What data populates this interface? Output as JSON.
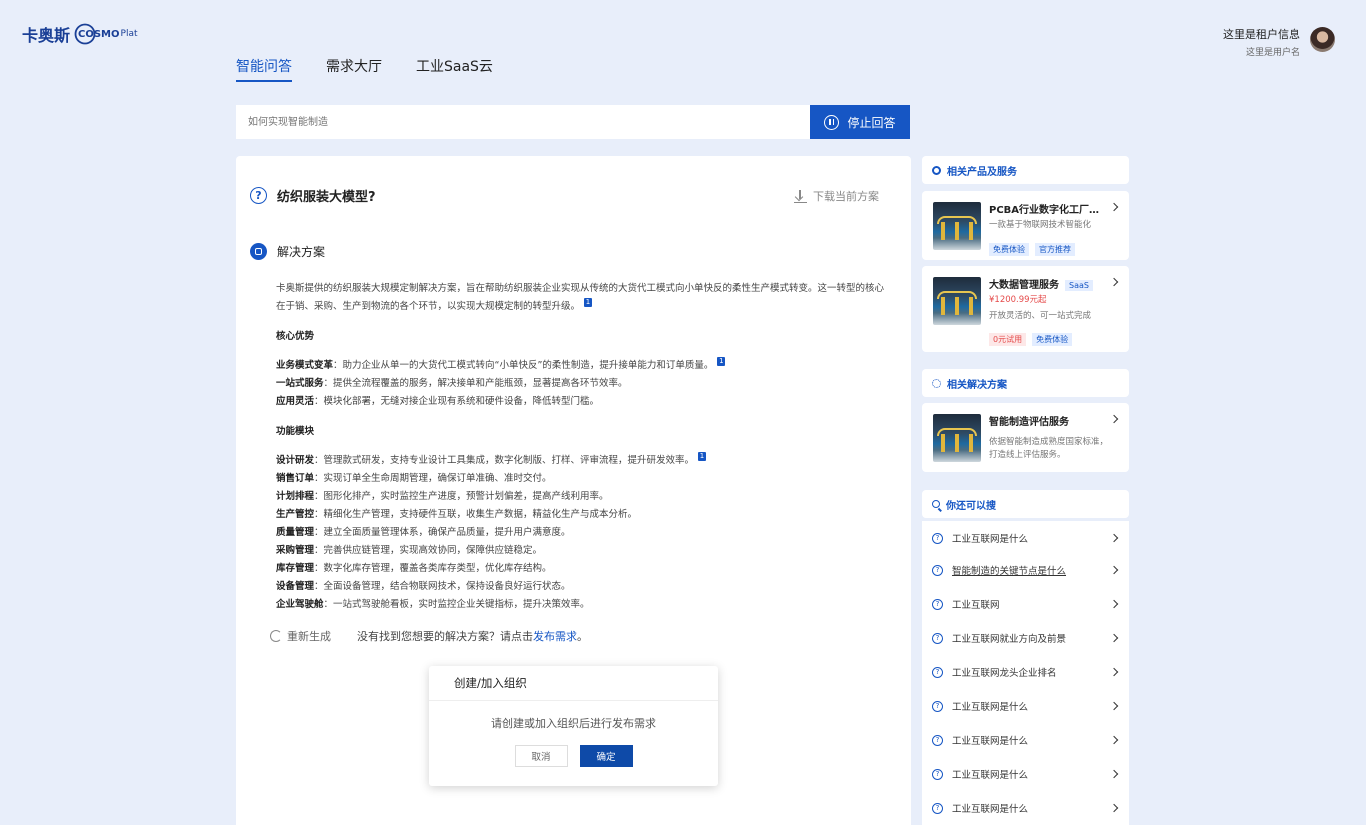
{
  "brand": {
    "cn": "卡奥斯",
    "en": "COSMO",
    "en_small": "Plat"
  },
  "tenant": {
    "title": "这里是租户信息",
    "user": "这里是用户名"
  },
  "tabs": [
    {
      "label": "智能问答",
      "active": true
    },
    {
      "label": "需求大厅",
      "active": false
    },
    {
      "label": "工业SaaS云",
      "active": false
    }
  ],
  "search": {
    "placeholder": "如何实现智能制造",
    "stop_label": "停止回答"
  },
  "question": {
    "title": "纺织服装大模型?",
    "download_label": "下载当前方案"
  },
  "solution": {
    "heading": "解决方案",
    "intro": "卡奥斯提供的纺织服装大规模定制解决方案，旨在帮助纺织服装企业实现从传统的大货代工模式向小单快反的柔性生产模式转变。这一转型的核心在于销、采购、生产到物流的各个环节，以实现大规模定制的转型升级。",
    "ref": "1",
    "core_title": "核心优势",
    "core": [
      {
        "term": "业务模式变革",
        "text": "：助力企业从单一的大货代工模式转向“小单快反”的柔性制造，提升接单能力和订单质量。",
        "ref": "1"
      },
      {
        "term": "一站式服务",
        "text": "：提供全流程覆盖的服务，解决接单和产能瓶颈，显著提高各环节效率。",
        "ref": ""
      },
      {
        "term": "应用灵活",
        "text": "：模块化部署，无缝对接企业现有系统和硬件设备，降低转型门槛。",
        "ref": ""
      }
    ],
    "func_title": "功能模块",
    "func": [
      {
        "term": "设计研发",
        "text": "：管理款式研发，支持专业设计工具集成，数字化制版、打样、评审流程，提升研发效率。",
        "ref": "1"
      },
      {
        "term": "销售订单",
        "text": "：实现订单全生命周期管理，确保订单准确、准时交付。",
        "ref": ""
      },
      {
        "term": "计划排程",
        "text": "：图形化排产，实时监控生产进度，预警计划偏差，提高产线利用率。",
        "ref": ""
      },
      {
        "term": "生产管控",
        "text": "：精细化生产管理，支持硬件互联，收集生产数据，精益化生产与成本分析。",
        "ref": ""
      },
      {
        "term": "质量管理",
        "text": "：建立全面质量管理体系，确保产品质量，提升用户满意度。",
        "ref": ""
      },
      {
        "term": "采购管理",
        "text": "：完善供应链管理，实现高效协同，保障供应链稳定。",
        "ref": ""
      },
      {
        "term": "库存管理",
        "text": "：数字化库存管理，覆盖各类库存类型，优化库存结构。",
        "ref": ""
      },
      {
        "term": "设备管理",
        "text": "：全面设备管理，结合物联网技术，保持设备良好运行状态。",
        "ref": ""
      },
      {
        "term": "企业驾驶舱",
        "text": "：一站式驾驶舱看板，实时监控企业关键指标，提升决策效率。",
        "ref": ""
      }
    ],
    "regenerate": "重新生成",
    "not_found": "没有找到您想要的解决方案？请点击",
    "publish": "发布需求",
    "period": "。"
  },
  "modal": {
    "title": "创建/加入组织",
    "body": "请创建或加入组织后进行发布需求",
    "cancel": "取消",
    "ok": "确定"
  },
  "sidebar": {
    "products_title": "相关产品及服务",
    "products": [
      {
        "name": "PCBA行业数字化工厂解决方案",
        "desc": "一款基于物联网技术智能化",
        "tags": [
          "免费体验",
          "官方推荐"
        ]
      },
      {
        "name": "大数据管理服务",
        "badge": "SaaS",
        "price": "¥1200.99元起",
        "desc": "开放灵活的、可一站式完成",
        "tags": [
          "0元试用",
          "免费体验"
        ]
      }
    ],
    "solutions_title": "相关解决方案",
    "solutions": [
      {
        "name": "智能制造评估服务",
        "desc1": "依据智能制造成熟度国家标准，",
        "desc2": "打造线上评估服务。"
      }
    ],
    "search_title": "你还可以搜",
    "searches": [
      "工业互联网是什么",
      "智能制造的关键节点是什么",
      "工业互联网",
      "工业互联网就业方向及前景",
      "工业互联网龙头企业排名",
      "工业互联网是什么",
      "工业互联网是什么",
      "工业互联网是什么",
      "工业互联网是什么"
    ]
  },
  "colors": {
    "primary": "#1656c4",
    "background": "#e8eefa",
    "price": "#e54b4b"
  }
}
